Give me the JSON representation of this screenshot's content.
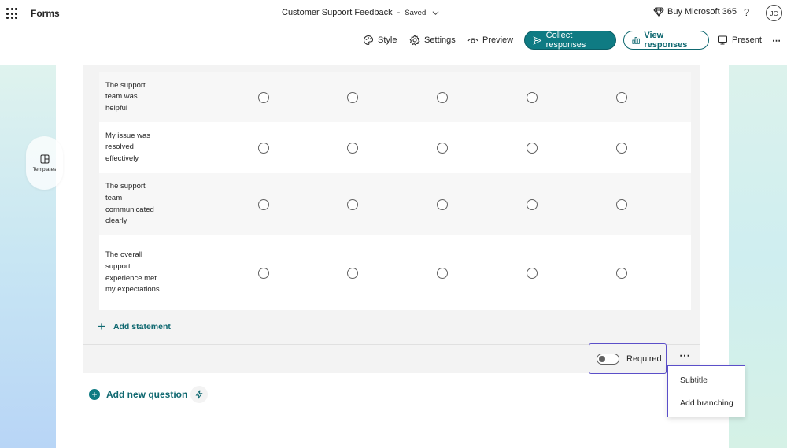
{
  "app": {
    "name": "Forms"
  },
  "document": {
    "title": "Customer Supoort Feedback",
    "separator": "-",
    "status": "Saved"
  },
  "header": {
    "buy_label": "Buy Microsoft 365",
    "help_label": "?",
    "avatar_initials": "JC"
  },
  "toolbar": {
    "style_label": "Style",
    "settings_label": "Settings",
    "preview_label": "Preview",
    "collect_label": "Collect responses",
    "view_label": "View responses",
    "present_label": "Present",
    "more_label": "⋯"
  },
  "sidebar": {
    "templates_label": "Templates"
  },
  "question": {
    "statements": [
      {
        "label": "The support team was helpful"
      },
      {
        "label": "My issue was resolved effectively"
      },
      {
        "label": "The support team communicated clearly"
      },
      {
        "label": "The overall support experience met my expectations"
      }
    ],
    "columns_count": 5,
    "add_statement_label": "Add statement",
    "required_label": "Required",
    "required_on": false,
    "more_label": "⋯"
  },
  "context_menu": {
    "items": [
      "Subtitle",
      "Add branching"
    ]
  },
  "add_question_label": "Add new question",
  "colors": {
    "accent": "#0f7b83",
    "focus_outline": "#5b4fc9"
  },
  "icons": {
    "app_launcher": "waffle-icon",
    "buy": "diamond-icon",
    "style": "palette-icon",
    "settings": "gear-icon",
    "preview": "eye-icon",
    "collect": "send-icon",
    "view": "bar-chart-icon",
    "present": "monitor-icon",
    "templates": "template-icon",
    "add_question": "plus-circle-icon",
    "quick_add": "lightning-icon"
  }
}
